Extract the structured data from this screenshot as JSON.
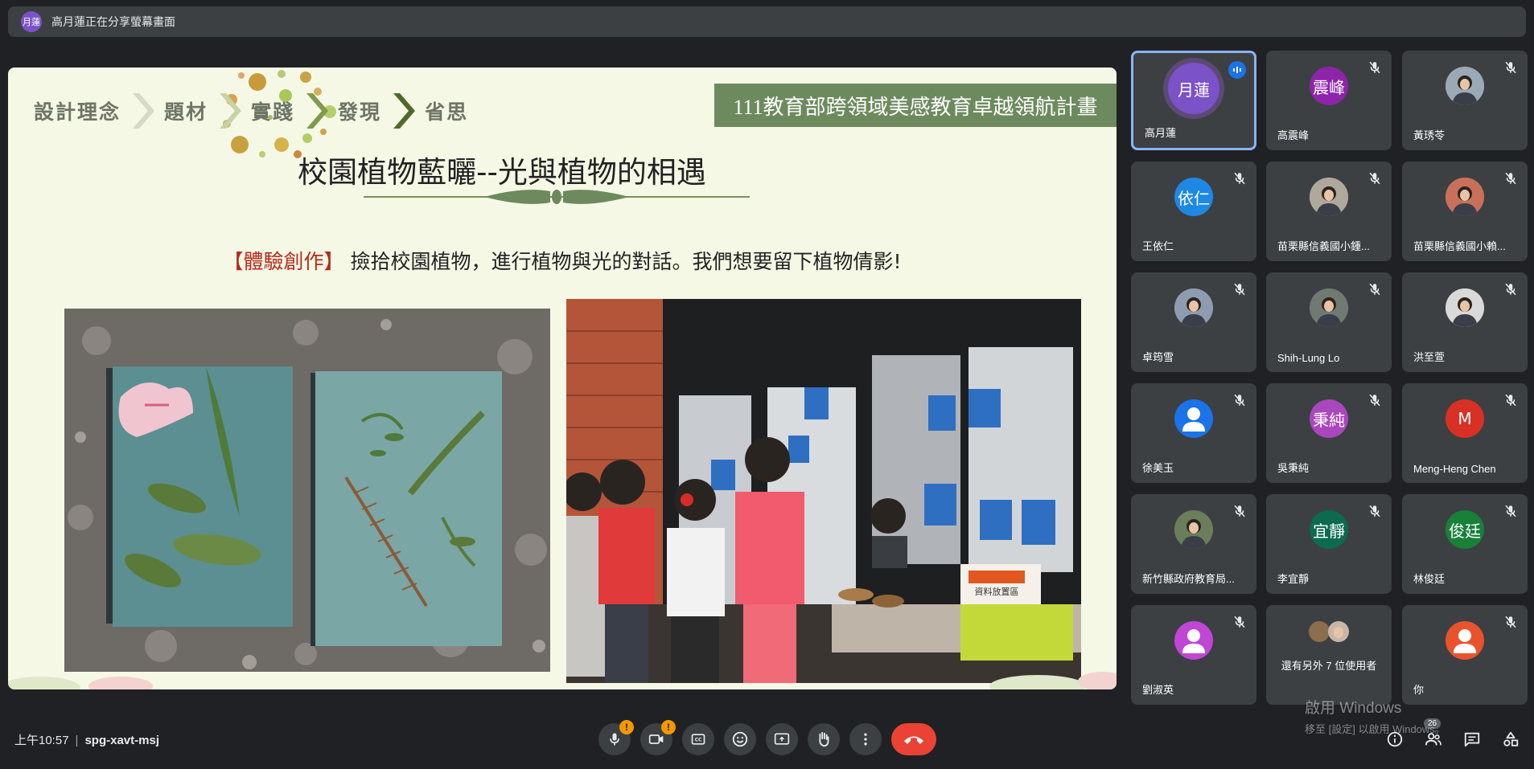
{
  "share_bar": {
    "avatar_text": "月蓮",
    "text": "高月蓮正在分享螢幕畫面"
  },
  "slide": {
    "breadcrumbs": [
      "設計理念",
      "題材",
      "實踐",
      "發現",
      "省思"
    ],
    "banner": "111教育部跨領域美感教育卓越領航計畫",
    "title": "校園植物藍曬--光與植物的相遇",
    "subtitle_tag": "【體驗創作】",
    "subtitle_text": " 撿拾校園植物，進行植物與光的對話。我們想要留下植物倩影!",
    "sign_text": "資料放置區"
  },
  "participants": [
    {
      "name": "高月蓮",
      "avatar": "月蓮",
      "color": "#7b52c7",
      "speaking": true
    },
    {
      "name": "高震峰",
      "avatar": "震峰",
      "color": "#8e24aa"
    },
    {
      "name": "黃琇苓",
      "avatar": "",
      "color": "#9aa9b5",
      "photo": true
    },
    {
      "name": "王依仁",
      "avatar": "依仁",
      "color": "#1e88e5"
    },
    {
      "name": "苗栗縣信義國小鍾...",
      "avatar": "",
      "color": "#b0a89c",
      "photo": true
    },
    {
      "name": "苗栗縣信義國小賴...",
      "avatar": "",
      "color": "#c9705b",
      "photo": true
    },
    {
      "name": "卓筠雪",
      "avatar": "",
      "color": "#8f9bb0",
      "photo": true
    },
    {
      "name": "Shih-Lung Lo",
      "avatar": "",
      "color": "#707a73",
      "photo": true
    },
    {
      "name": "洪至萱",
      "avatar": "",
      "color": "#d9d9d9",
      "photo": true
    },
    {
      "name": "徐美玉",
      "avatar": "",
      "color": "#1a73e8",
      "person": true
    },
    {
      "name": "吳秉純",
      "avatar": "秉純",
      "color": "#ab47bc"
    },
    {
      "name": "Meng-Heng Chen",
      "avatar": "M",
      "color": "#d93025"
    },
    {
      "name": "新竹縣政府教育局...",
      "avatar": "",
      "color": "#6b7d5a",
      "photo": true
    },
    {
      "name": "李宜靜",
      "avatar": "宜靜",
      "color": "#0b6b4f"
    },
    {
      "name": "林俊廷",
      "avatar": "俊廷",
      "color": "#188038"
    },
    {
      "name": "劉淑英",
      "avatar": "",
      "color": "#c046d6",
      "person": true
    },
    {
      "name": "還有另外 7 位使用者",
      "avatar": "",
      "color": "#5f6368",
      "others": true
    },
    {
      "name": "你",
      "avatar": "",
      "color": "#e8532d",
      "person": true
    }
  ],
  "controls": {
    "time": "上午10:57",
    "meeting_code": "spg-xavt-msj",
    "people_count": "26"
  },
  "watermark": {
    "line1": "啟用 Windows",
    "line2": "移至 [設定] 以啟用 Windows。"
  }
}
